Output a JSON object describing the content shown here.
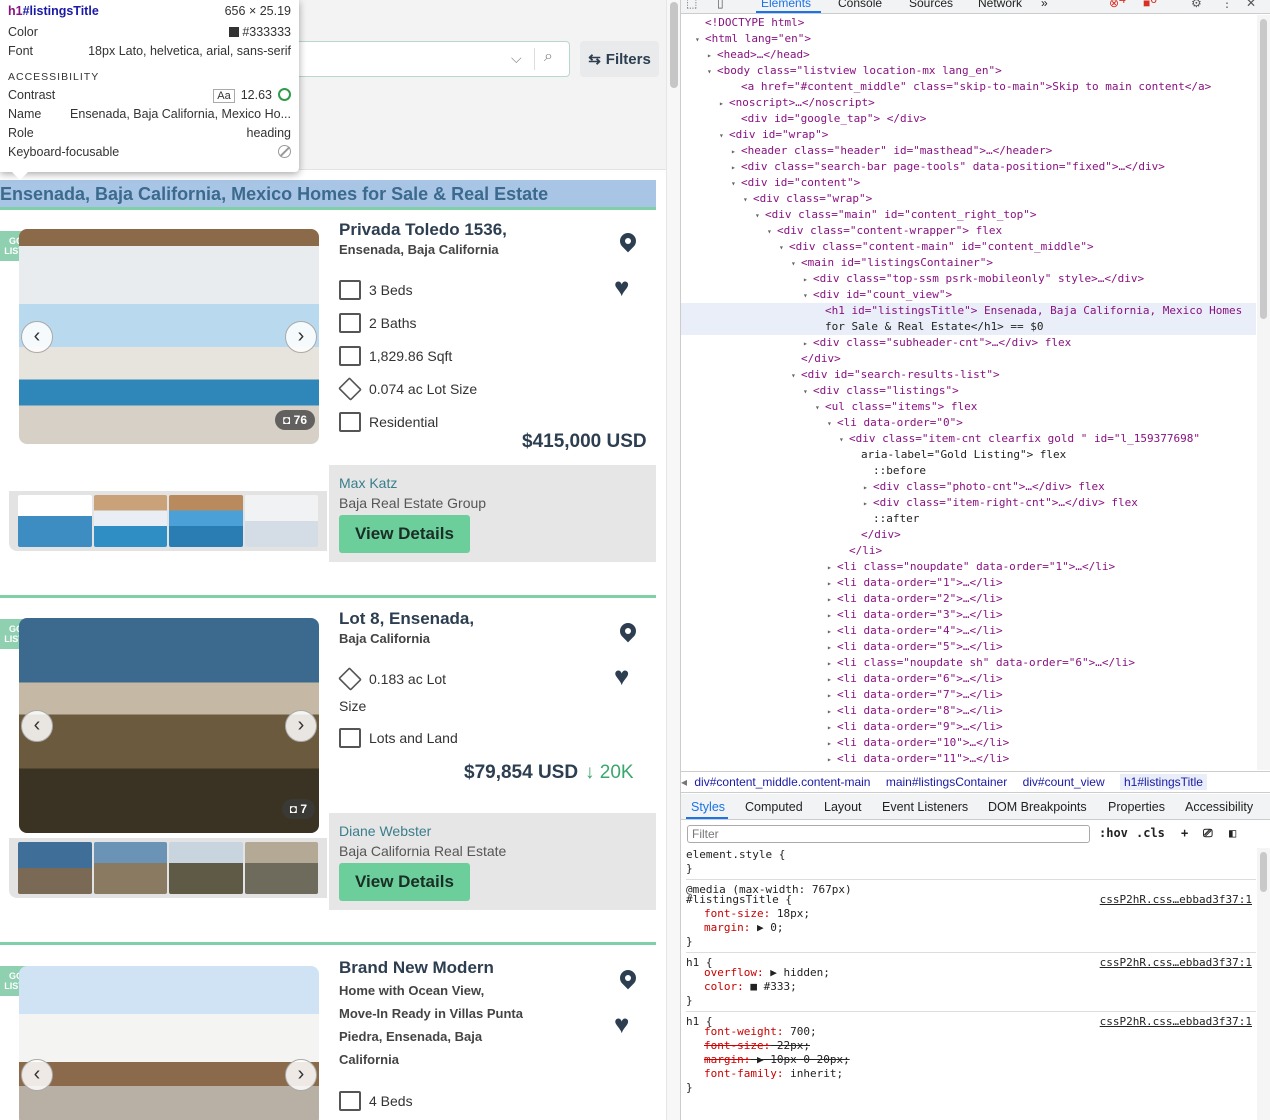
{
  "tooltip": {
    "selector_tag": "h1",
    "selector_id": "#listingsTitle",
    "size": "656 × 25.19",
    "color_label": "Color",
    "color_value": "#333333",
    "font_label": "Font",
    "font_value": "18px Lato, helvetica, arial, sans-serif",
    "accessibility_label": "ACCESSIBILITY",
    "contrast_label": "Contrast",
    "contrast_aa": "Aa",
    "contrast_value": "12.63",
    "name_label": "Name",
    "name_value": "Ensenada, Baja California, Mexico Ho...",
    "role_label": "Role",
    "role_value": "heading",
    "kbd_label": "Keyboard-focusable"
  },
  "search": {
    "filters_label": "Filters",
    "chevron": "⌵",
    "search_icon": "⌕"
  },
  "listings_title": "Ensenada, Baja California, Mexico Homes for Sale & Real Estate",
  "listings": [
    {
      "badge": "GOLD LISTING",
      "address1": "Privada Toledo 1536,",
      "address2": "Ensenada, Baja California",
      "features": [
        "3 Beds",
        "2 Baths",
        "1,829.86 Sqft",
        "0.074 ac Lot Size",
        "Residential"
      ],
      "price": "$415,000 USD",
      "photo_count": "76",
      "agent": "Max Katz",
      "agency": "Baja Real Estate Group",
      "button": "View Details"
    },
    {
      "badge": "GOLD LISTING",
      "address1": "Lot 8, Ensenada,",
      "address2": "Baja California",
      "features": [
        "0.183 ac Lot",
        "Size",
        "Lots and Land"
      ],
      "price": "$79,854 USD",
      "price_drop": "↓ 20K",
      "photo_count": "7",
      "agent": "Diane Webster",
      "agency": "Baja California Real Estate",
      "button": "View Details"
    },
    {
      "badge": "GOLD LISTING",
      "address1": "Brand New Modern",
      "address2_lines": [
        "Home with Ocean View,",
        "Move-In Ready in Villas Punta",
        "Piedra, Ensenada, Baja",
        "California"
      ],
      "features": [
        "4 Beds"
      ]
    }
  ],
  "devtools": {
    "tabs": [
      "Elements",
      "Console",
      "Sources",
      "Network",
      "»"
    ],
    "errors": "4",
    "warnings": "6",
    "breadcrumbs": [
      "div#content_middle.content-main",
      "main#listingsContainer",
      "div#count_view",
      "h1#listingsTitle"
    ],
    "subtabs": [
      "Styles",
      "Computed",
      "Layout",
      "Event Listeners",
      "DOM Breakpoints",
      "Properties",
      "Accessibility"
    ],
    "filter_placeholder": "Filter",
    "hov": ":hov",
    "cls": ".cls",
    "dom_lines": [
      "<!DOCTYPE html>",
      "<html lang=\"en\">",
      "<head>…</head>",
      "<body class=\"listview location-mx lang_en\">",
      "<a href=\"#content_middle\" class=\"skip-to-main\">Skip to main content</a>",
      "<noscript>…</noscript>",
      "<div id=\"google_tap\"> </div>",
      "<div id=\"wrap\">",
      "<header class=\"header\" id=\"masthead\">…</header>",
      "<div class=\"search-bar page-tools\" data-position=\"fixed\">…</div>",
      "<div id=\"content\">",
      "<div class=\"wrap\">",
      "<div class=\"main\" id=\"content_right_top\">",
      "<div class=\"content-wrapper\"> flex",
      "<div class=\"content-main\" id=\"content_middle\">",
      "<main id=\"listingsContainer\">",
      "<div class=\"top-ssm psrk-mobileonly\" style>…</div>",
      "<div id=\"count_view\">",
      "<h1 id=\"listingsTitle\"> Ensenada, Baja California, Mexico Homes",
      "for Sale & Real Estate</h1> == $0",
      "<div class=\"subheader-cnt\">…</div> flex",
      "</div>",
      "<div id=\"search-results-list\">",
      "<div class=\"listings\">",
      "<ul class=\"items\"> flex",
      "<li data-order=\"0\">",
      "<div class=\"item-cnt clearfix gold  \" id=\"l_159377698\"",
      "aria-label=\"Gold Listing\"> flex",
      "::before",
      "<div class=\"photo-cnt\">…</div> flex",
      "<div class=\"item-right-cnt\">…</div> flex",
      "::after",
      "</div>",
      "</li>",
      "<li class=\"noupdate\" data-order=\"1\">…</li>",
      "<li data-order=\"1\">…</li>",
      "<li data-order=\"2\">…</li>",
      "<li data-order=\"3\">…</li>",
      "<li data-order=\"4\">…</li>",
      "<li data-order=\"5\">…</li>",
      "<li class=\"noupdate sh\" data-order=\"6\">…</li>",
      "<li data-order=\"6\">…</li>",
      "<li data-order=\"7\">…</li>",
      "<li data-order=\"8\">…</li>",
      "<li data-order=\"9\">…</li>",
      "<li data-order=\"10\">…</li>",
      "<li data-order=\"11\">…</li>"
    ],
    "styles_lines": [
      "element.style {",
      "}",
      "@media (max-width: 767px)",
      "#listingsTitle {",
      "font-size: 18px;",
      "margin: ▶ 0;",
      "}",
      "h1 {",
      "overflow: ▶ hidden;",
      "color: ■ #333;",
      "}",
      "h1 {",
      "font-weight: 700;",
      "font-size: 22px;",
      "margin: ▶ 10px 0 20px;",
      "font-family: inherit;",
      "}"
    ],
    "style_source": "cssP2hR.css…ebbad3f37:1"
  }
}
